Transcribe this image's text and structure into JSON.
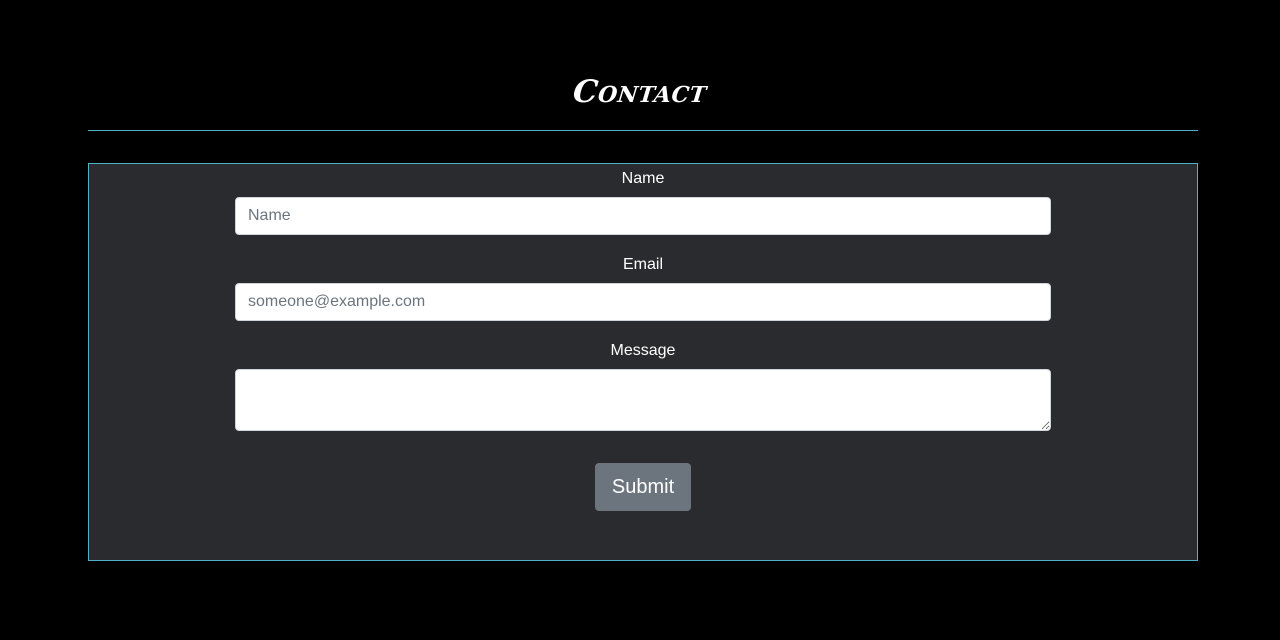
{
  "header": {
    "title": "Contact"
  },
  "form": {
    "name_label": "Name",
    "name_placeholder": "Name",
    "email_label": "Email",
    "email_placeholder": "someone@example.com",
    "message_label": "Message",
    "message_placeholder": "",
    "submit_label": "Submit"
  },
  "colors": {
    "background": "#000000",
    "panel": "#2a2b2e",
    "accent_border": "#4fb3c8",
    "button": "#6c757d",
    "text": "#ffffff"
  }
}
